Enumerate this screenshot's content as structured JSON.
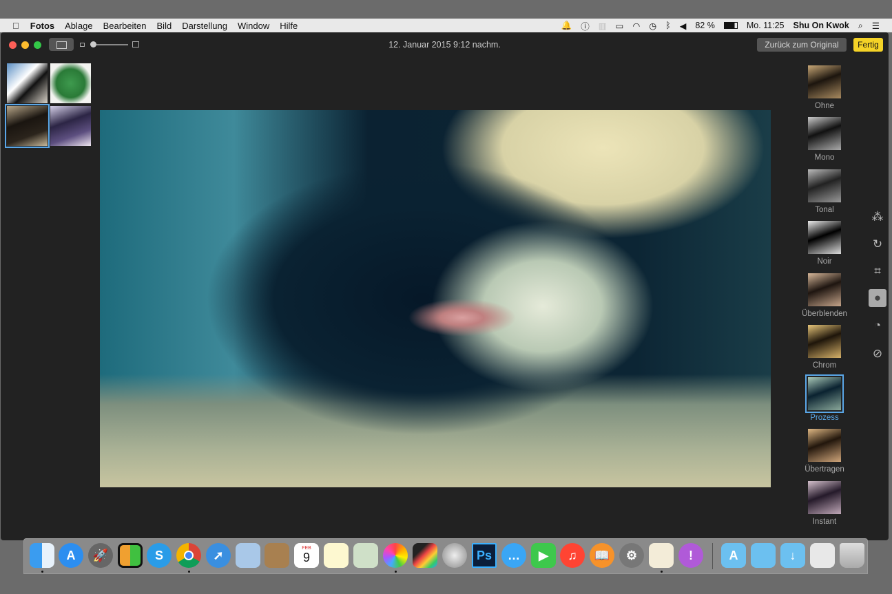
{
  "menubar": {
    "apple": "",
    "app": "Fotos",
    "items": [
      "Ablage",
      "Bearbeiten",
      "Bild",
      "Darstellung",
      "Window",
      "Hilfe"
    ],
    "status": {
      "battery": "82 %",
      "clock": "Mo. 11:25",
      "user": "Shu On Kwok"
    }
  },
  "window": {
    "title": "12. Januar 2015 9:12 nachm.",
    "revert_label": "Zurück zum Original",
    "done_label": "Fertig"
  },
  "filters": [
    {
      "label": "Ohne"
    },
    {
      "label": "Mono"
    },
    {
      "label": "Tonal"
    },
    {
      "label": "Noir"
    },
    {
      "label": "Überblenden"
    },
    {
      "label": "Chrom"
    },
    {
      "label": "Prozess",
      "selected": true
    },
    {
      "label": "Übertragen"
    },
    {
      "label": "Instant"
    }
  ],
  "tools": [
    "magic-wand-icon",
    "rotate-icon",
    "crop-icon",
    "filters-icon",
    "adjust-icon",
    "retouch-icon"
  ],
  "dock": {
    "apps": [
      "Finder",
      "App Store",
      "Launchpad",
      "Mission Control",
      "Skype",
      "Chrome",
      "Safari",
      "Vorschau",
      "Kontakte",
      "Kalender",
      "Notizen",
      "Karten",
      "Fotos",
      "Final Cut Pro",
      "Motion",
      "Photoshop",
      "Nachrichten",
      "FaceTime",
      "iTunes",
      "iBooks",
      "Systemeinstellungen",
      "TextEdit",
      "Feedback"
    ],
    "folders": [
      "Programme",
      "Dokumente",
      "Downloads",
      "Chrome Datei",
      "Papierkorb"
    ],
    "calendar_day": "9",
    "calendar_month": "FEB",
    "photoshop_label": "Ps",
    "skype_label": "S"
  },
  "colors": {
    "accent": "#5aa7e8",
    "done": "#f5d327"
  }
}
